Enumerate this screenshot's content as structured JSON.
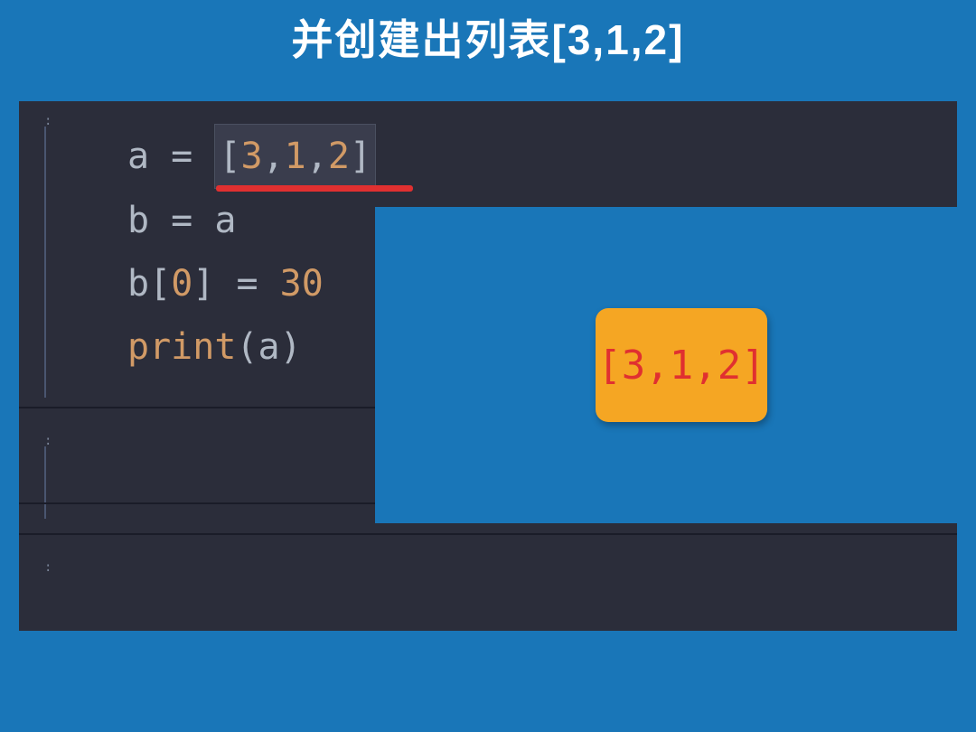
{
  "title": "并创建出列表[3,1,2]",
  "code": {
    "line1": {
      "var": "a",
      "eq": " = ",
      "lb": "[",
      "n1": "3",
      "c1": ",",
      "n2": "1",
      "c2": ",",
      "n3": "2",
      "rb": "]"
    },
    "line2": {
      "var": "b",
      "eq": " = ",
      "rhs": "a"
    },
    "line3": {
      "var": "b",
      "lb": "[",
      "idx": "0",
      "rb": "]",
      "eq": " = ",
      "val": "30"
    },
    "line4": {
      "fn": "print",
      "lp": "(",
      "arg": "a",
      "rp": ")"
    }
  },
  "illustration": {
    "list_value": "[3,1,2]"
  }
}
